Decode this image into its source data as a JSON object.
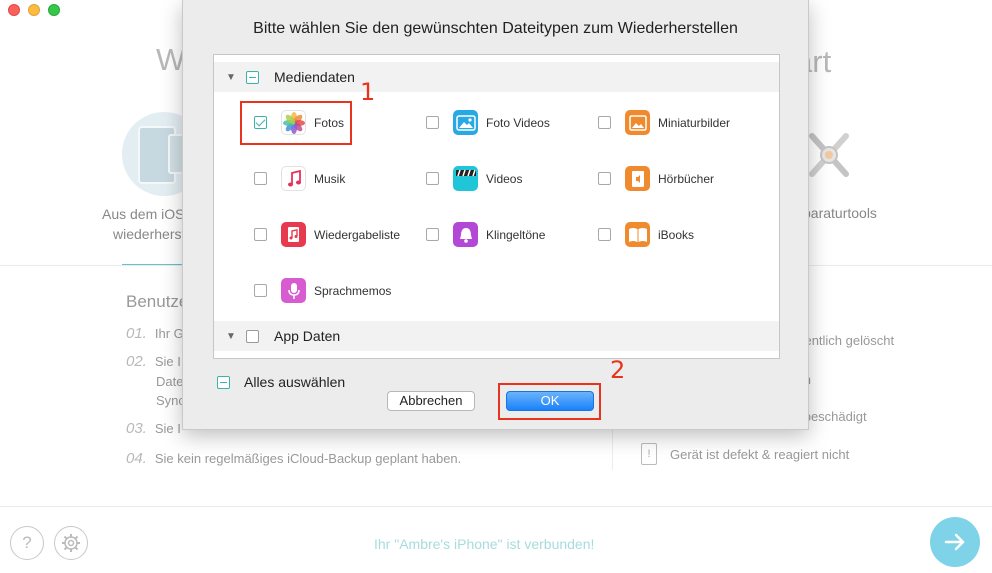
{
  "background": {
    "title_left": "W",
    "title_right": "art",
    "left_option": {
      "line1": "Aus dem iOS",
      "line2": "wiederherst"
    },
    "right_option": {
      "label": "paraturtools"
    },
    "section_title": "Benutze",
    "steps": [
      {
        "num": "01.",
        "text": "Ihr G"
      },
      {
        "num": "02.",
        "text": "Sie I",
        "cont1": "Date",
        "cont2": "Sync"
      },
      {
        "num": "03.",
        "text": "Sie I"
      },
      {
        "num": "04.",
        "text": "Sie kein regelmäßiges iCloud-Backup geplant haben."
      }
    ],
    "right_items": [
      {
        "text": "ehentlich gelöscht"
      },
      {
        "text": "sen"
      },
      {
        "text": "st beschädigt"
      }
    ],
    "broken_device_label": "Gerät ist defekt & reagiert nicht",
    "broken_device_glyph": "!",
    "help_glyph": "?",
    "status_text": "Ihr \"Ambre's iPhone\" ist verbunden!"
  },
  "dialog": {
    "title": "Bitte wählen Sie den gewünschten Dateitypen zum Wiederherstellen",
    "groups": [
      {
        "label": "Mediendaten",
        "expanded": true,
        "state": "indeterminate"
      },
      {
        "label": "App Daten",
        "expanded": false,
        "state": "unchecked"
      }
    ],
    "media_items": [
      {
        "label": "Fotos",
        "checked": true,
        "icon": "photos-icon"
      },
      {
        "label": "Foto Videos",
        "checked": false,
        "icon": "photo-videos-icon"
      },
      {
        "label": "Miniaturbilder",
        "checked": false,
        "icon": "thumbnails-icon"
      },
      {
        "label": "Musik",
        "checked": false,
        "icon": "music-icon"
      },
      {
        "label": "Videos",
        "checked": false,
        "icon": "videos-icon"
      },
      {
        "label": "Hörbücher",
        "checked": false,
        "icon": "audiobooks-icon"
      },
      {
        "label": "Wiedergabeliste",
        "checked": false,
        "icon": "playlist-icon"
      },
      {
        "label": "Klingeltöne",
        "checked": false,
        "icon": "ringtones-icon"
      },
      {
        "label": "iBooks",
        "checked": false,
        "icon": "ibooks-icon"
      },
      {
        "label": "Sprachmemos",
        "checked": false,
        "icon": "voice-memos-icon"
      }
    ],
    "select_all_label": "Alles auswählen",
    "cancel_label": "Abbrechen",
    "ok_label": "OK"
  },
  "annotations": [
    {
      "number": "1",
      "color": "#e8341c"
    },
    {
      "number": "2",
      "color": "#e8341c"
    }
  ],
  "colors": {
    "accent": "#3cb3a8",
    "ok_button": "#1a82fb",
    "highlight": "#e8341c",
    "status": "#a8dcdc"
  }
}
